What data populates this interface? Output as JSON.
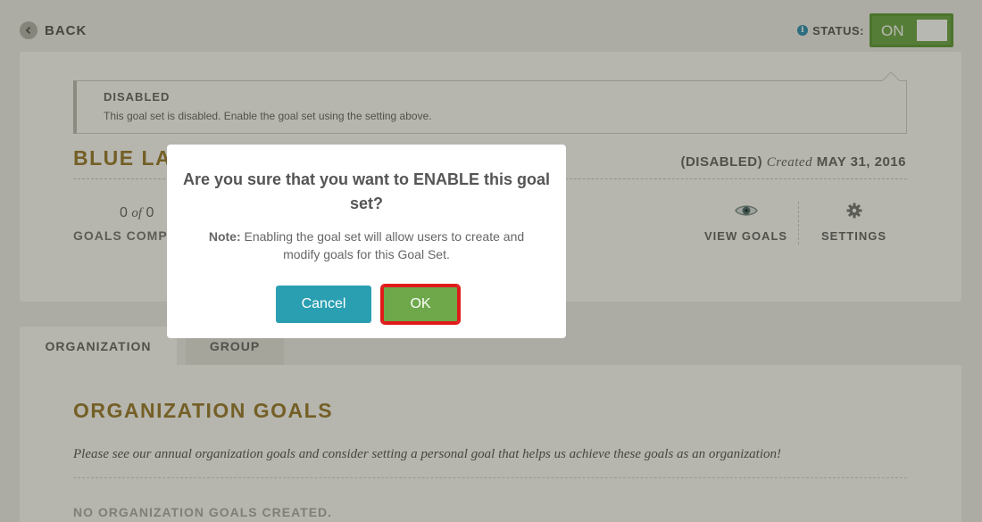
{
  "topbar": {
    "back_label": "BACK",
    "status_label": "STATUS:",
    "toggle_text": "ON"
  },
  "notice": {
    "title": "DISABLED",
    "text": "This goal set is disabled. Enable the goal set using the setting above."
  },
  "goal_set": {
    "title": "BLUE LAG",
    "state": "(DISABLED)",
    "created_label": "Created",
    "created_date": "MAY 31, 2016",
    "completed_count": "0",
    "of_word": "of",
    "total_count": "0",
    "completed_label": "GOALS COMP"
  },
  "actions": {
    "view_goals": "VIEW GOALS",
    "settings": "SETTINGS"
  },
  "tabs": [
    {
      "label": "ORGANIZATION"
    },
    {
      "label": "GROUP"
    }
  ],
  "org": {
    "title": "ORGANIZATION GOALS",
    "description": "Please see our annual organization goals and consider setting a personal goal that helps us achieve these goals as an organization!",
    "empty_text": "NO ORGANIZATION GOALS CREATED."
  },
  "modal": {
    "title": "Are you sure that you want to ENABLE this goal set?",
    "note_label": "Note:",
    "note_text": "Enabling the goal set will allow users to create and modify goals for this Goal Set.",
    "cancel_label": "Cancel",
    "ok_label": "OK"
  },
  "colors": {
    "accent_gold": "#9a7b2f",
    "toggle_green": "#6ea84a",
    "cancel_teal": "#2a9fb2",
    "highlight_red": "#e01a1a"
  },
  "icons": {
    "back": "chevron-left-icon",
    "info": "info-icon",
    "view": "eye-icon",
    "settings": "gear-icon"
  }
}
